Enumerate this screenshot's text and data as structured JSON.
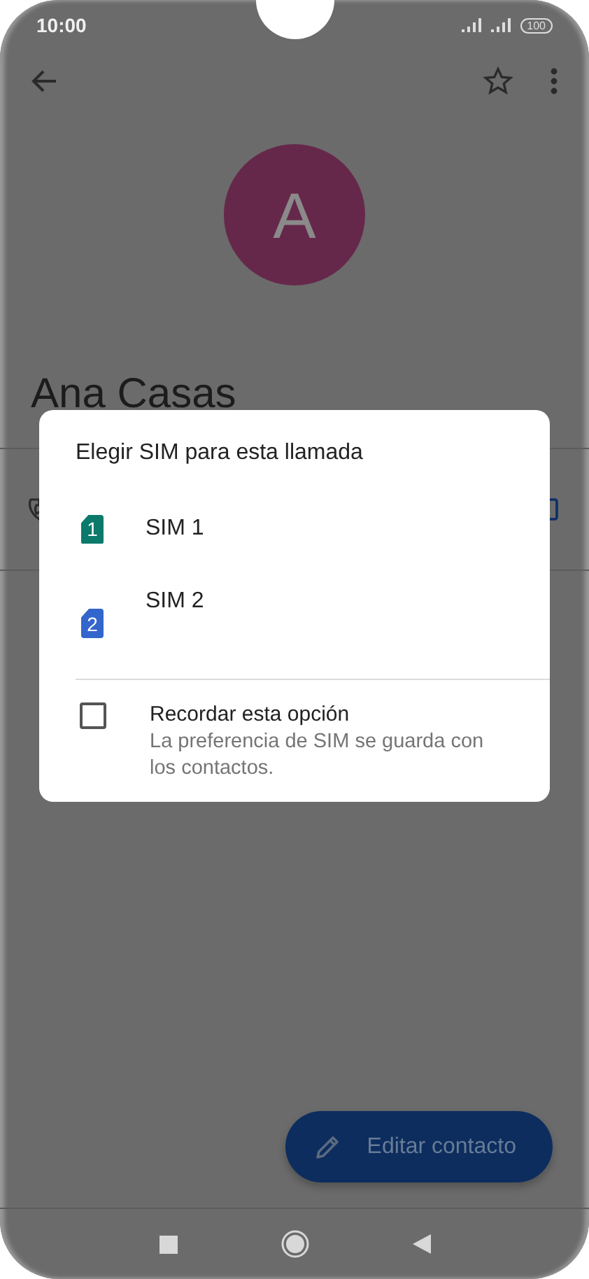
{
  "status_bar": {
    "time": "10:00",
    "battery": "100"
  },
  "contact": {
    "avatar_letter": "A",
    "name": "Ana Casas"
  },
  "dialog": {
    "title": "Elegir SIM para esta llamada",
    "sims": [
      {
        "number": "1",
        "label": "SIM 1",
        "color": "#0b7a6a"
      },
      {
        "number": "2",
        "label": "SIM 2",
        "color": "#3366cc"
      }
    ],
    "remember": {
      "label": "Recordar esta opción",
      "description": "La preferencia de SIM se guarda con los contactos.",
      "checked": false
    }
  },
  "fab": {
    "label": "Editar contacto"
  }
}
